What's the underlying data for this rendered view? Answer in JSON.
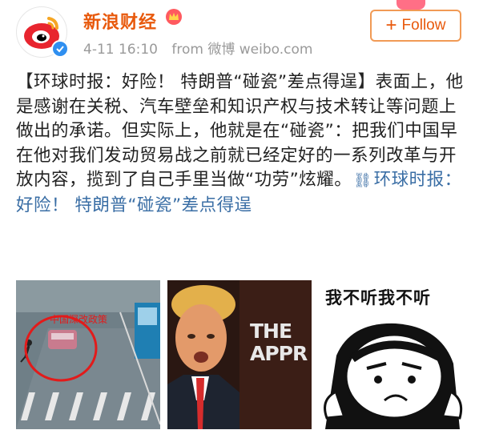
{
  "header": {
    "username": "新浪财经",
    "timestamp": "4-11 16:10",
    "source_prefix": "from",
    "source": "微博 weibo.com",
    "follow_label": "Follow",
    "follow_plus": "+"
  },
  "post": {
    "body": "【环球时报：好险！ 特朗普“碰瓷”差点得逞】表面上，他是感谢在关税、汽车壁垒和知识产权与技术转让等问题上做出的承诺。但实际上，他就是在“碰瓷”：把我们中国早在他对我们发动贸易战之前就已经定好的一系列改革与开放内容，揽到了自己手里当做“功劳”炫耀。",
    "link_text": "环球时报：好险！ 特朗普“碰瓷”差点得逞"
  },
  "images": {
    "img1_caption": "中国深改政策",
    "img2_text": "THE APPR",
    "img3_caption": "我不听我不听"
  },
  "colors": {
    "accent": "#e8590c",
    "link": "#3a6ea5",
    "verified": "#2f8ff0"
  }
}
